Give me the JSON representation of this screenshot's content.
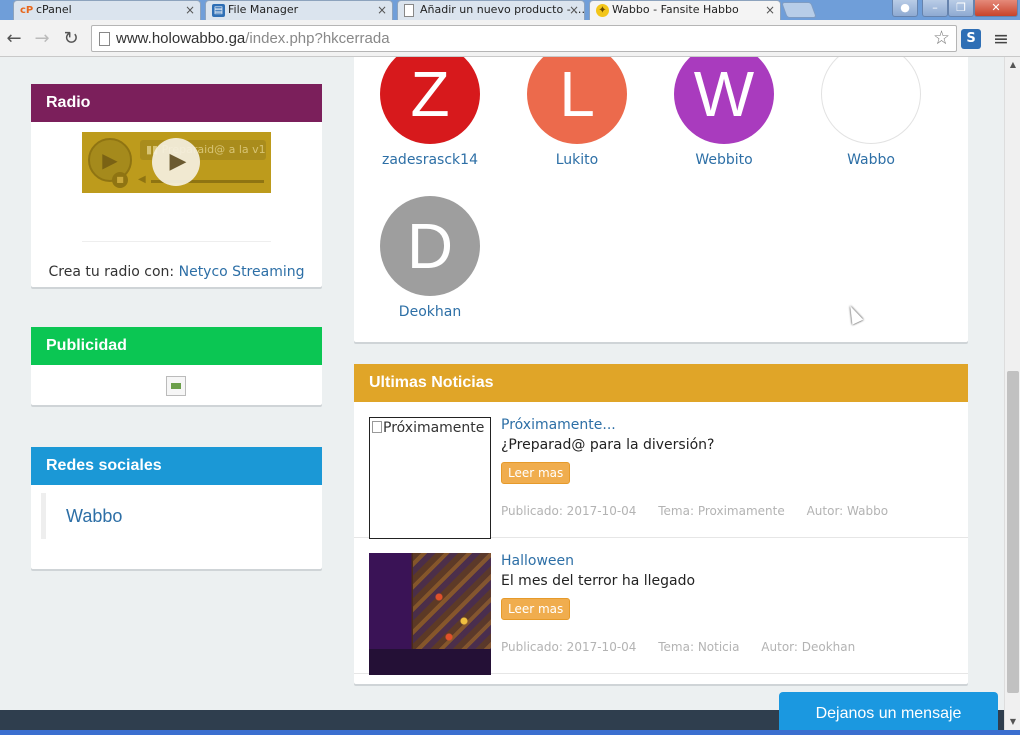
{
  "browser": {
    "tabs": [
      {
        "title": "cPanel",
        "icon": "cpanel-icon",
        "active": false
      },
      {
        "title": "File Manager",
        "icon": "file-manager-icon",
        "active": false
      },
      {
        "title": "Añadir un nuevo producto - …",
        "icon": "page-icon",
        "active": false
      },
      {
        "title": "Wabbo - Fansite Habbo",
        "icon": "wabbo-icon",
        "active": true
      }
    ],
    "url_host": "www.holowabbo.ga",
    "url_path": "/index.php?hkcerrada",
    "tab_close_glyph": "×"
  },
  "sidebar": {
    "radio": {
      "title": "Radio",
      "track": "Preparaid@ a la v1",
      "credit_prefix": "Crea tu radio con:",
      "credit_link": "Netyco Streaming",
      "color": "#7b1f5b"
    },
    "ads": {
      "title": "Publicidad",
      "color": "#0bc653"
    },
    "social": {
      "title": "Redes sociales",
      "link": "Wabbo",
      "color": "#1b98d6"
    }
  },
  "users": [
    {
      "name": "zadesrasck14",
      "initial": "Z",
      "color": "#d7191c"
    },
    {
      "name": "Lukito",
      "initial": "L",
      "color": "#ec6a4c"
    },
    {
      "name": "Webbito",
      "initial": "W",
      "color": "#a93bbe"
    },
    {
      "name": "Wabbo",
      "initial": "",
      "color": "#ffffff"
    },
    {
      "name": "Deokhan",
      "initial": "D",
      "color": "#9e9e9e"
    }
  ],
  "news": {
    "title": "Ultimas Noticias",
    "color": "#e0a528",
    "items": [
      {
        "title": "Próximamente...",
        "desc": "¿Preparad@ para la diversión?",
        "button": "Leer mas",
        "published": "Publicado: 2017-10-04",
        "topic": "Tema: Proximamente",
        "author": "Autor: Wabbo",
        "image_alt": "Próximamente"
      },
      {
        "title": "Halloween",
        "desc": "El mes del terror ha llegado",
        "button": "Leer mas",
        "published": "Publicado: 2017-10-04",
        "topic": "Tema: Noticia",
        "author": "Autor: Deokhan",
        "image_alt": ""
      }
    ]
  },
  "chat": {
    "label": "Dejanos un mensaje",
    "color": "#1b98e0"
  }
}
